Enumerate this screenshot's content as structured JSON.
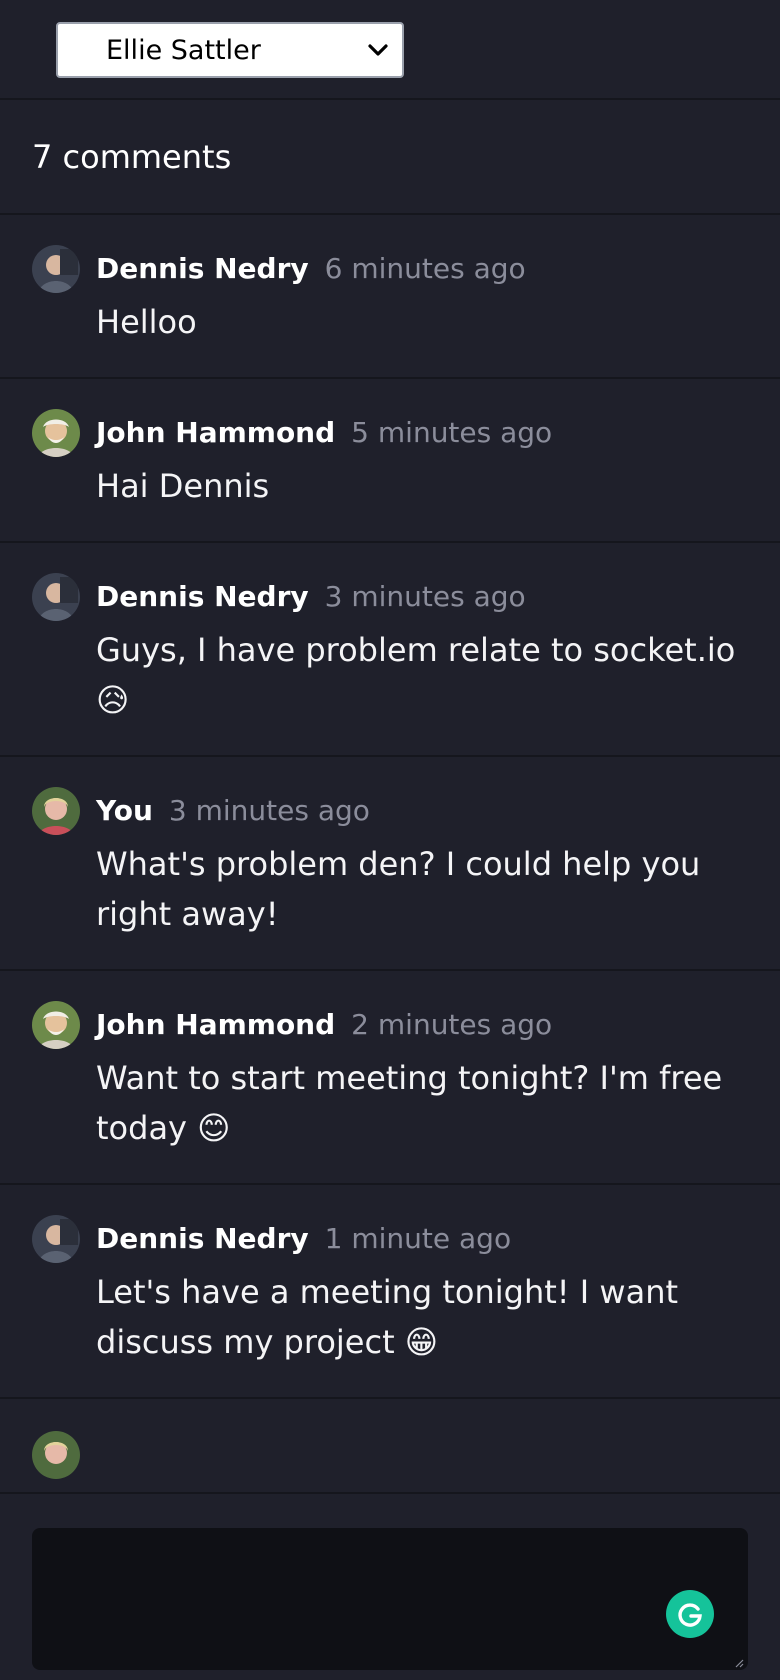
{
  "header": {
    "selected_user": "Ellie Sattler",
    "icon": "chevron-down-icon"
  },
  "comments_count_label": "7 comments",
  "comments": [
    {
      "author": "Dennis Nedry",
      "time": "6 minutes ago",
      "text": "Helloo",
      "avatar": "avatar-dennis"
    },
    {
      "author": "John Hammond",
      "time": "5 minutes ago",
      "text": "Hai Dennis",
      "avatar": "avatar-john"
    },
    {
      "author": "Dennis Nedry",
      "time": "3 minutes ago",
      "text": "Guys, I have problem relate to socket.io 😥",
      "avatar": "avatar-dennis"
    },
    {
      "author": "You",
      "time": "3 minutes ago",
      "text": "What's problem den? I could help you right away!",
      "avatar": "avatar-you"
    },
    {
      "author": "John Hammond",
      "time": "2 minutes ago",
      "text": "Want to start meeting tonight? I'm free today 😊",
      "avatar": "avatar-john"
    },
    {
      "author": "Dennis Nedry",
      "time": "1 minute ago",
      "text": "Let's have a meeting tonight! I want discuss my project 😁",
      "avatar": "avatar-dennis"
    }
  ],
  "composer": {
    "value": "",
    "placeholder": "",
    "assistant_icon": "grammarly-icon"
  },
  "colors": {
    "background": "#1f202b",
    "divider": "#15161d",
    "muted_text": "#8b8d9b",
    "composer_bg": "#0f1015",
    "assistant_green": "#15c39a"
  }
}
